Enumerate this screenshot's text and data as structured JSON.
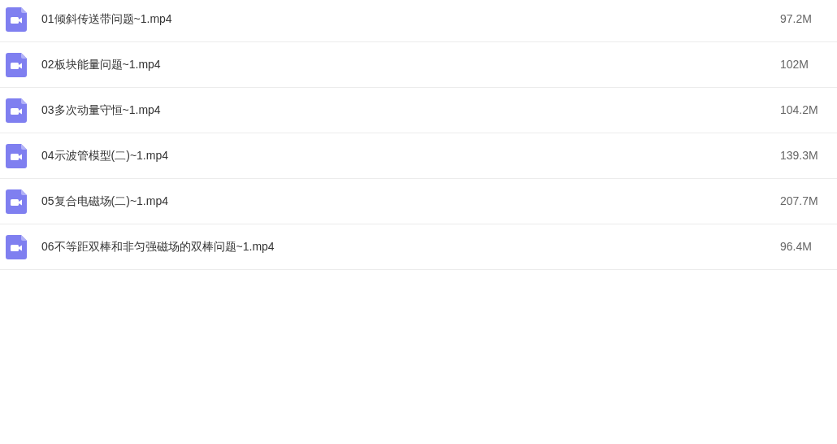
{
  "files": [
    {
      "name": "01倾斜传送带问题~1.mp4",
      "size": "97.2M"
    },
    {
      "name": "02板块能量问题~1.mp4",
      "size": "102M"
    },
    {
      "name": "03多次动量守恒~1.mp4",
      "size": "104.2M"
    },
    {
      "name": "04示波管模型(二)~1.mp4",
      "size": "139.3M"
    },
    {
      "name": "05复合电磁场(二)~1.mp4",
      "size": "207.7M"
    },
    {
      "name": "06不等距双棒和非匀强磁场的双棒问题~1.mp4",
      "size": "96.4M"
    }
  ]
}
